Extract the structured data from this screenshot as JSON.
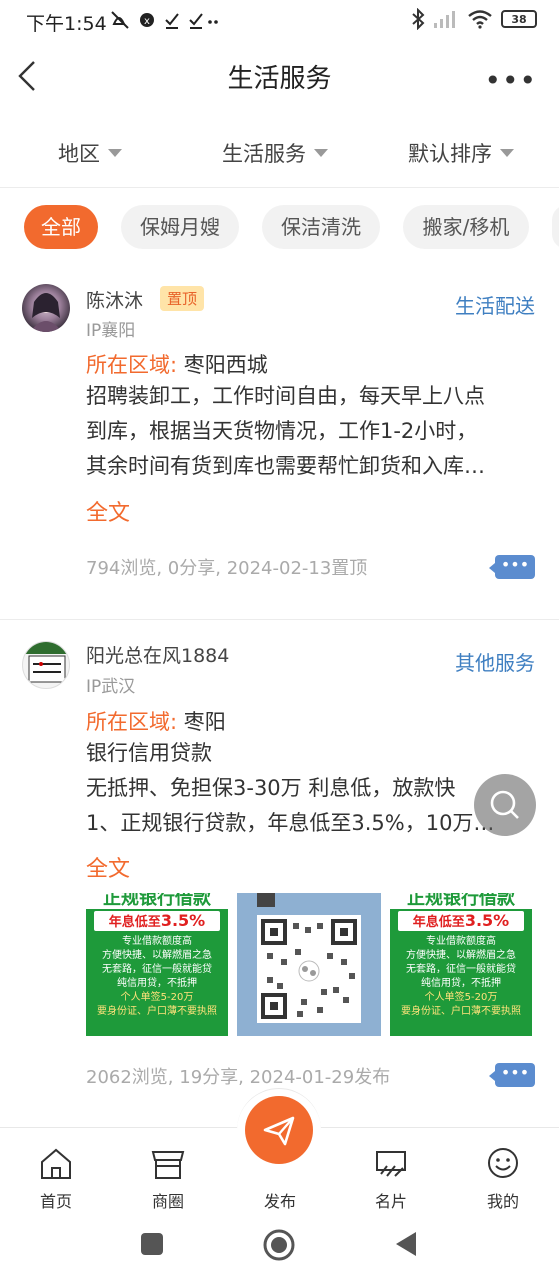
{
  "status": {
    "time": "下午1:54",
    "battery": "38"
  },
  "header": {
    "title": "生活服务"
  },
  "filters": [
    {
      "label": "地区"
    },
    {
      "label": "生活服务"
    },
    {
      "label": "默认排序"
    }
  ],
  "categories": [
    "全部",
    "保姆月嫂",
    "保洁清洗",
    "搬家/移机"
  ],
  "posts": [
    {
      "name": "陈沐沐",
      "badge": "置顶",
      "ip": "IP襄阳",
      "category": "生活配送",
      "region_label": "所在区域:",
      "region": "枣阳西城",
      "lines": [
        "招聘装卸工，工作时间自由，每天早上八点",
        "到库，根据当天货物情况，工作1-2小时，",
        "其余时间有货到库也需要帮忙卸货和入库…"
      ],
      "full": "全文",
      "meta": "794浏览, 0分享, 2024-02-13置顶",
      "comment": "•••"
    },
    {
      "name": "阳光总在风1884",
      "ip": "IP武汉",
      "category": "其他服务",
      "region_label": "所在区域:",
      "region": "枣阳",
      "lines": [
        "银行信用贷款",
        "无抵押、免担保3-30万 利息低，放款快",
        "1、正规银行贷款，年息低至3.5%，10万…"
      ],
      "full": "全文",
      "meta": "2062浏览, 19分享, 2024-01-29发布",
      "comment": "•••",
      "ad": {
        "headline": "正规银行借款",
        "rate": "年息低至3.5%",
        "rate_prefix": "年息低至",
        "rate_value": "3.5%",
        "l1": "专业借款额度高",
        "l2": "方便快捷、以解燃眉之急",
        "l3": "无套路，征信一般就能贷",
        "l4": "纯信用贷，不抵押",
        "l5": "个人单签5-20万",
        "l6": "要身份证、户口薄不要执照"
      }
    }
  ],
  "nav": [
    {
      "label": "首页"
    },
    {
      "label": "商圈"
    },
    {
      "label": "发布"
    },
    {
      "label": "名片"
    },
    {
      "label": "我的"
    }
  ],
  "colors": {
    "accent": "#f26a2e",
    "link": "#3f7fc1",
    "ad_green": "#1e9a3a",
    "ad_red": "#e02020"
  }
}
